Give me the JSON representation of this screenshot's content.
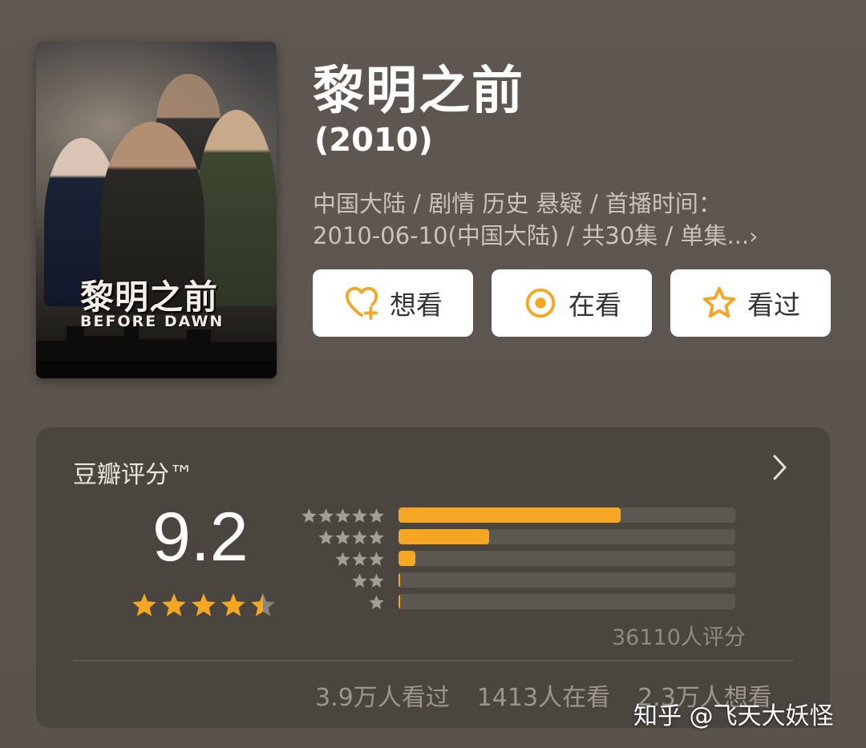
{
  "movie": {
    "title": "黎明之前",
    "year": "(2010)",
    "meta_line1": "中国大陆 / 剧情 历史 悬疑 / 首播时间：",
    "meta_line2": "2010-06-10(中国大陆) / 共30集 / 单集...",
    "poster": {
      "title": "黎明之前",
      "subtitle": "BEFORE DAWN"
    }
  },
  "actions": {
    "want": {
      "label": "想看",
      "icon": "heart-plus-icon"
    },
    "doing": {
      "label": "在看",
      "icon": "target-circle-icon"
    },
    "done": {
      "label": "看过",
      "icon": "star-outline-icon"
    }
  },
  "rating": {
    "label": "豆瓣评分™",
    "score": "9.2",
    "score_stars": 4.5,
    "distribution": [
      {
        "stars": 5,
        "fraction": 0.66
      },
      {
        "stars": 4,
        "fraction": 0.27
      },
      {
        "stars": 3,
        "fraction": 0.05
      },
      {
        "stars": 2,
        "fraction": 0.005
      },
      {
        "stars": 1,
        "fraction": 0.005
      }
    ],
    "count": "36110人评分"
  },
  "stats": {
    "watched": "3.9万人看过",
    "watching": "1413人在看",
    "want": "2.3万人想看"
  },
  "watermark": "知乎 @飞天大妖怪",
  "colors": {
    "accent": "#f5a623",
    "background": "#5e5650",
    "card": "#4b4540",
    "inactive_star": "#8a847e"
  }
}
